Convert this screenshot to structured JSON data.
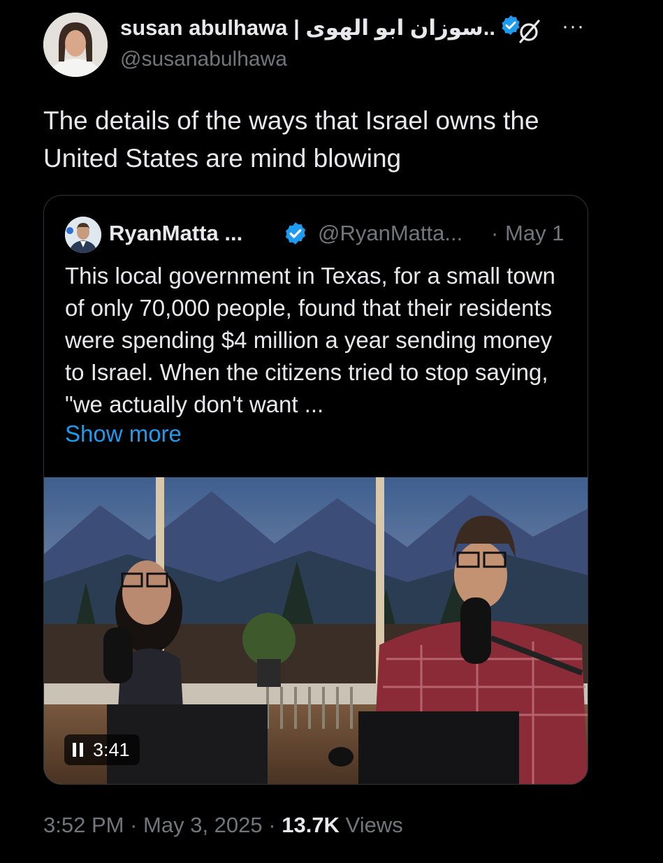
{
  "author": {
    "name": "susan abulhawa | سوزان ابو الهوى..",
    "handle": "@susanabulhawa"
  },
  "tweet": {
    "text": "The details of the ways that Israel owns the United States are mind blowing",
    "time": "3:52 PM",
    "date": "May 3, 2025",
    "views_count": "13.7K",
    "views_label": "Views",
    "separator": "·"
  },
  "quote": {
    "name": "RyanMatta ...",
    "handle": "@RyanMatta...",
    "separator": "·",
    "date": "May 1",
    "text": "This local government in Texas, for a small town of only 70,000 people, found that their residents were spending $4 million a year sending money to Israel. When the citizens tried to stop saying, \"we actually don't want ...",
    "show_more": "Show more",
    "video": {
      "duration": "3:41"
    }
  },
  "icons": {
    "verified": "verified-badge-icon",
    "grok": "grok-icon",
    "more": "more-options-icon",
    "pause": "pause-icon"
  },
  "colors": {
    "background": "#000000",
    "text": "#e7e9ea",
    "muted": "#71767b",
    "accent": "#1d9bf0",
    "border": "#2f3336"
  }
}
